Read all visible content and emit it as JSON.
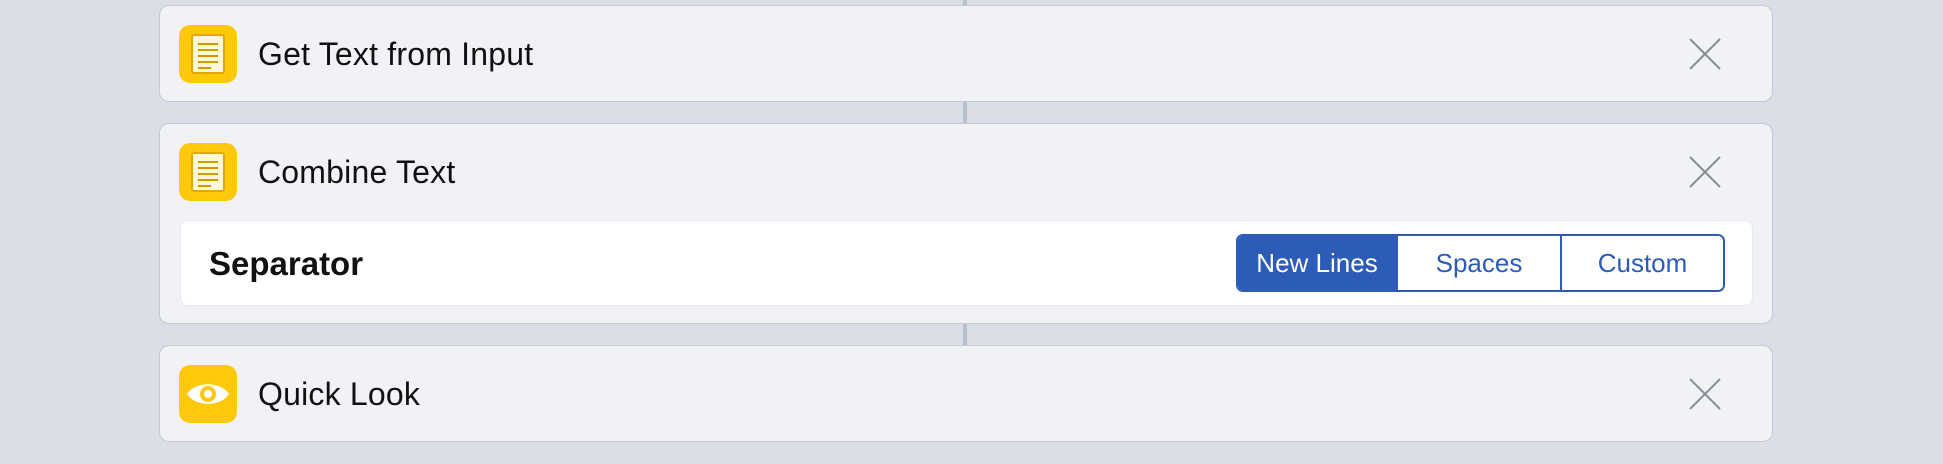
{
  "accent_color": "#2c5bb8",
  "icon_color": "#ffc80a",
  "actions": [
    {
      "title": "Get Text from Input",
      "icon": "document-icon",
      "close": "close-icon"
    },
    {
      "title": "Combine Text",
      "icon": "document-icon",
      "close": "close-icon",
      "parameter": {
        "label": "Separator",
        "options": [
          "New Lines",
          "Spaces",
          "Custom"
        ],
        "selected": "New Lines"
      }
    },
    {
      "title": "Quick Look",
      "icon": "eye-icon",
      "close": "close-icon"
    }
  ]
}
